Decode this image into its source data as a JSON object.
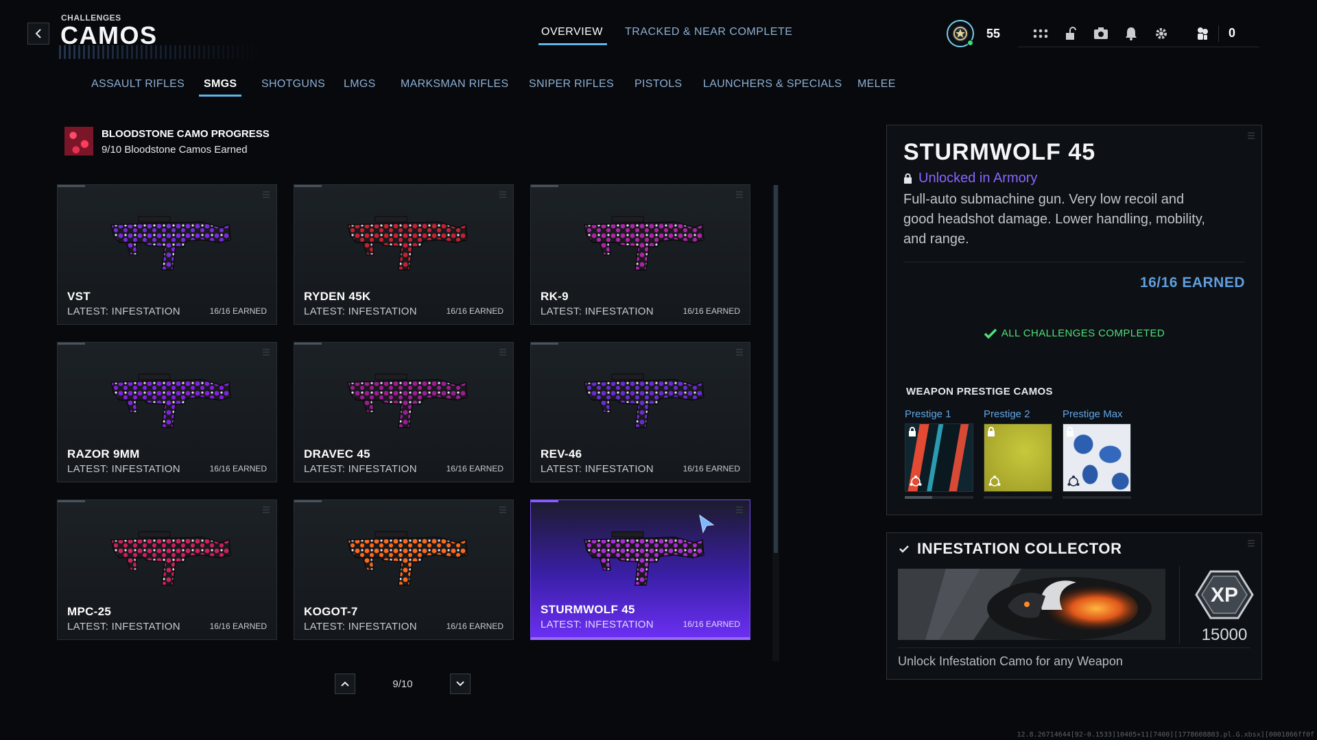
{
  "header": {
    "eyebrow": "CHALLENGES",
    "title": "CAMOS",
    "tabs": [
      {
        "label": "OVERVIEW",
        "active": true
      },
      {
        "label": "TRACKED & NEAR COMPLETE",
        "active": false
      }
    ]
  },
  "hud": {
    "level": "55",
    "currency": "0"
  },
  "categories": [
    {
      "label": "ASSAULT RIFLES"
    },
    {
      "label": "SMGS",
      "active": true
    },
    {
      "label": "SHOTGUNS"
    },
    {
      "label": "LMGS"
    },
    {
      "label": "MARKSMAN RIFLES"
    },
    {
      "label": "SNIPER RIFLES"
    },
    {
      "label": "PISTOLS"
    },
    {
      "label": "LAUNCHERS & SPECIALS"
    },
    {
      "label": "MELEE"
    }
  ],
  "progress": {
    "title": "BLOODSTONE CAMO PROGRESS",
    "subtitle": "9/10 Bloodstone Camos Earned"
  },
  "weapons": [
    {
      "name": "VST",
      "latest": "LATEST: INFESTATION",
      "earned": "16/16 EARNED",
      "color": "#7a2ae0"
    },
    {
      "name": "RYDEN 45K",
      "latest": "LATEST: INFESTATION",
      "earned": "16/16 EARNED",
      "color": "#c8202e"
    },
    {
      "name": "RK-9",
      "latest": "LATEST: INFESTATION",
      "earned": "16/16 EARNED",
      "color": "#b023a8"
    },
    {
      "name": "RAZOR 9MM",
      "latest": "LATEST: INFESTATION",
      "earned": "16/16 EARNED",
      "color": "#8420e6"
    },
    {
      "name": "DRAVEC 45",
      "latest": "LATEST: INFESTATION",
      "earned": "16/16 EARNED",
      "color": "#a01c96"
    },
    {
      "name": "REV-46",
      "latest": "LATEST: INFESTATION",
      "earned": "16/16 EARNED",
      "color": "#6a2ad8"
    },
    {
      "name": "MPC-25",
      "latest": "LATEST: INFESTATION",
      "earned": "16/16 EARNED",
      "color": "#d0205a"
    },
    {
      "name": "KOGOT-7",
      "latest": "LATEST: INFESTATION",
      "earned": "16/16 EARNED",
      "color": "#ff6a18"
    },
    {
      "name": "STURMWOLF 45",
      "latest": "LATEST: INFESTATION",
      "earned": "16/16 EARNED",
      "color": "#b02ad8",
      "selected": true
    }
  ],
  "pager": {
    "text": "9/10"
  },
  "detail": {
    "name": "STURMWOLF 45",
    "unlock": "Unlocked in Armory",
    "description": "Full-auto submachine gun. Very low recoil and good headshot damage. Lower handling, mobility, and range.",
    "earned": "16/16 EARNED",
    "complete": "ALL CHALLENGES COMPLETED",
    "prestige_header": "WEAPON PRESTIGE CAMOS",
    "prestige": [
      {
        "label": "Prestige 1"
      },
      {
        "label": "Prestige 2"
      },
      {
        "label": "Prestige Max"
      }
    ]
  },
  "collector": {
    "title": "INFESTATION COLLECTOR",
    "xp_label": "XP",
    "xp": "15000",
    "description": "Unlock Infestation Camo for any Weapon"
  },
  "build": "12.8.26714644[92-0.1533]10405+11[7400][1778608803.pl.G.xbsx][0001866ff0f"
}
